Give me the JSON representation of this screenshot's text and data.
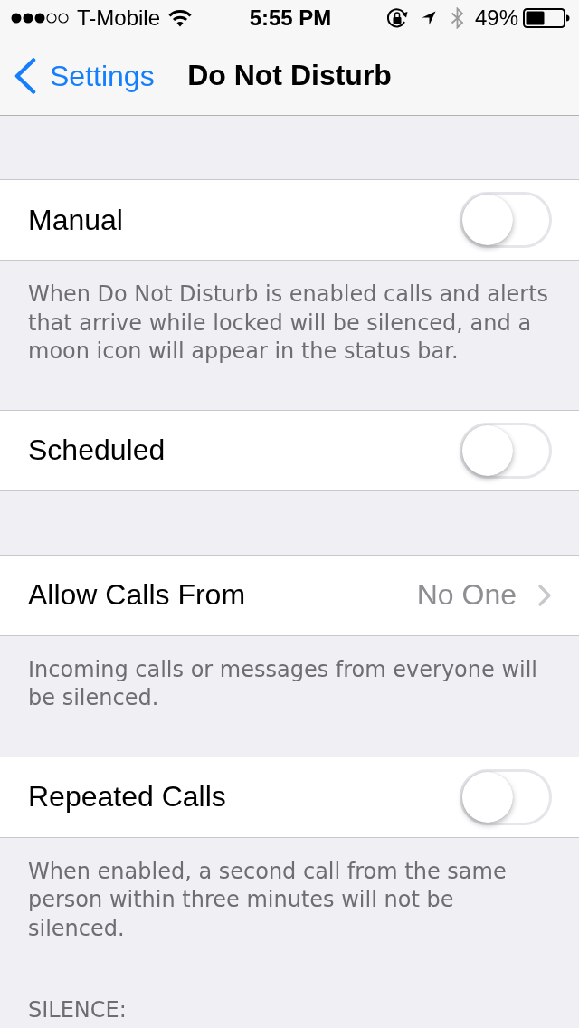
{
  "status_bar": {
    "carrier": "T-Mobile",
    "time": "5:55 PM",
    "battery": "49%"
  },
  "nav": {
    "back": "Settings",
    "title": "Do Not Disturb"
  },
  "groups": [
    {
      "rows": [
        {
          "kind": "toggle",
          "label": "Manual",
          "on": false
        }
      ],
      "footer": "When Do Not Disturb is enabled calls and alerts that arrive while locked will be silenced, and a moon icon will appear in the status bar."
    },
    {
      "rows": [
        {
          "kind": "toggle",
          "label": "Scheduled",
          "on": false
        }
      ]
    },
    {
      "rows": [
        {
          "kind": "disclosure",
          "label": "Allow Calls From",
          "value": "No One"
        }
      ],
      "footer": "Incoming calls or messages from everyone will be silenced."
    },
    {
      "rows": [
        {
          "kind": "toggle",
          "label": "Repeated Calls",
          "on": false
        }
      ],
      "footer": "When enabled, a second call from the same person within three minutes will not be silenced."
    },
    {
      "header": "SILENCE:"
    }
  ]
}
